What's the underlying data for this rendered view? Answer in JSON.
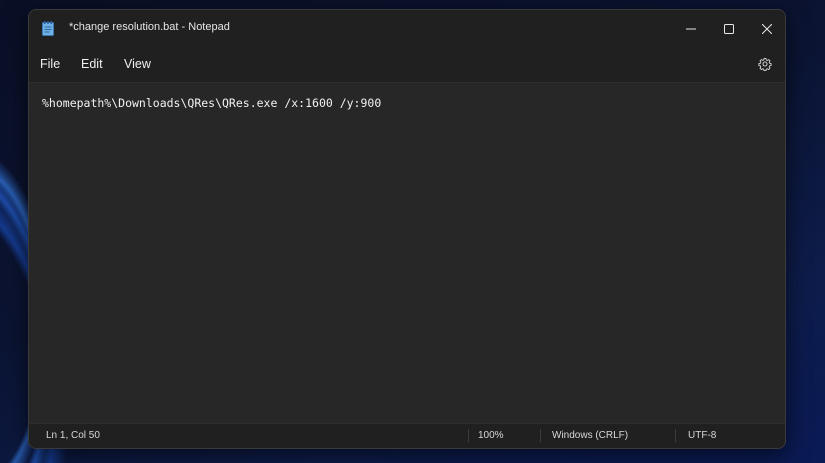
{
  "window": {
    "title": "*change resolution.bat - Notepad",
    "icon": "notepad-icon"
  },
  "titlebar_controls": {
    "minimize_icon": "minimize-icon",
    "maximize_icon": "maximize-icon",
    "close_icon": "close-icon"
  },
  "menu": {
    "items": [
      {
        "label": "File"
      },
      {
        "label": "Edit"
      },
      {
        "label": "View"
      }
    ],
    "settings_icon": "gear-icon"
  },
  "editor": {
    "content": "%homepath%\\Downloads\\QRes\\QRes.exe /x:1600 /y:900"
  },
  "statusbar": {
    "position": "Ln 1, Col 50",
    "zoom": "100%",
    "line_ending": "Windows (CRLF)",
    "encoding": "UTF-8"
  },
  "colors": {
    "window_bg": "#272727",
    "chrome_bg": "#202020",
    "text": "#f2f2f2",
    "desktop_accent": "#2f6fe8"
  }
}
